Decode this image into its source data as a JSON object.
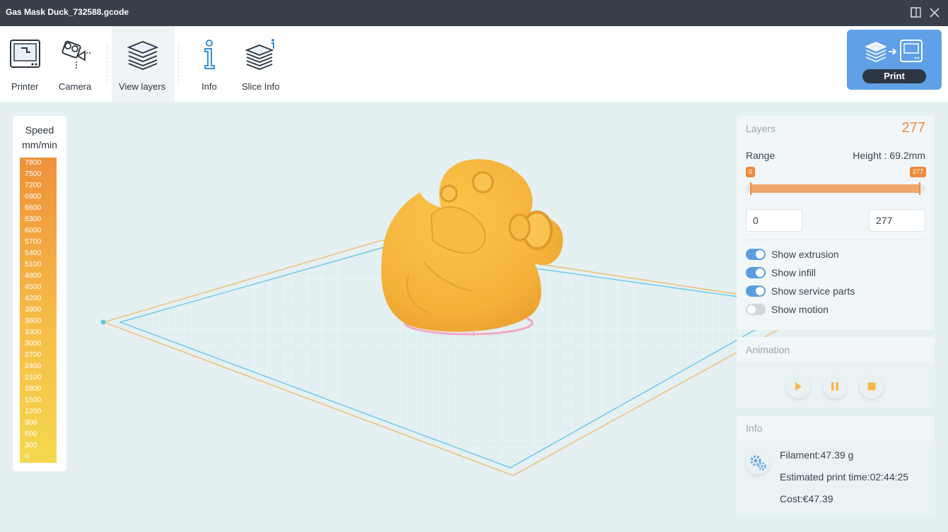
{
  "window": {
    "title": "Gas Mask Duck_732588.gcode"
  },
  "toolbar": {
    "items": [
      {
        "label": "Printer",
        "icon": "printer-icon"
      },
      {
        "label": "Camera",
        "icon": "camera-icon"
      },
      {
        "label": "View layers",
        "icon": "layers-icon",
        "active": true
      },
      {
        "label": "Info",
        "icon": "info-icon"
      },
      {
        "label": "Slice Info",
        "icon": "slice-info-icon"
      }
    ],
    "print_label": "Print"
  },
  "legend": {
    "title": "Speed",
    "unit": "mm/min",
    "ticks": [
      "7800",
      "7500",
      "7200",
      "6900",
      "6600",
      "6300",
      "6000",
      "5700",
      "5400",
      "5100",
      "4800",
      "4500",
      "4200",
      "3900",
      "3600",
      "3300",
      "3000",
      "2700",
      "2400",
      "2100",
      "1800",
      "1500",
      "1200",
      "900",
      "600",
      "300",
      "0"
    ]
  },
  "layers": {
    "title": "Layers",
    "count": "277",
    "range_label": "Range",
    "height_label": "Height : 69.2mm",
    "min_tag": "0",
    "max_tag": "277",
    "min_value": "0",
    "max_value": "277",
    "range_fraction": [
      0,
      1
    ],
    "toggles": [
      {
        "label": "Show extrusion",
        "on": true
      },
      {
        "label": "Show infill",
        "on": true
      },
      {
        "label": "Show service parts",
        "on": true
      },
      {
        "label": "Show motion",
        "on": false
      }
    ]
  },
  "animation": {
    "title": "Animation",
    "buttons": [
      "play-icon",
      "pause-icon",
      "stop-icon"
    ]
  },
  "info": {
    "title": "Info",
    "filament": "Filament:47.39 g",
    "print_time": "Estimated print time:02:44:25",
    "cost": "Cost:€47.39"
  },
  "colors": {
    "accent": "#ef8a3e",
    "print_button": "#5fa0e6",
    "model": "#f6b73c",
    "toggle_on": "#5b9ee0"
  }
}
